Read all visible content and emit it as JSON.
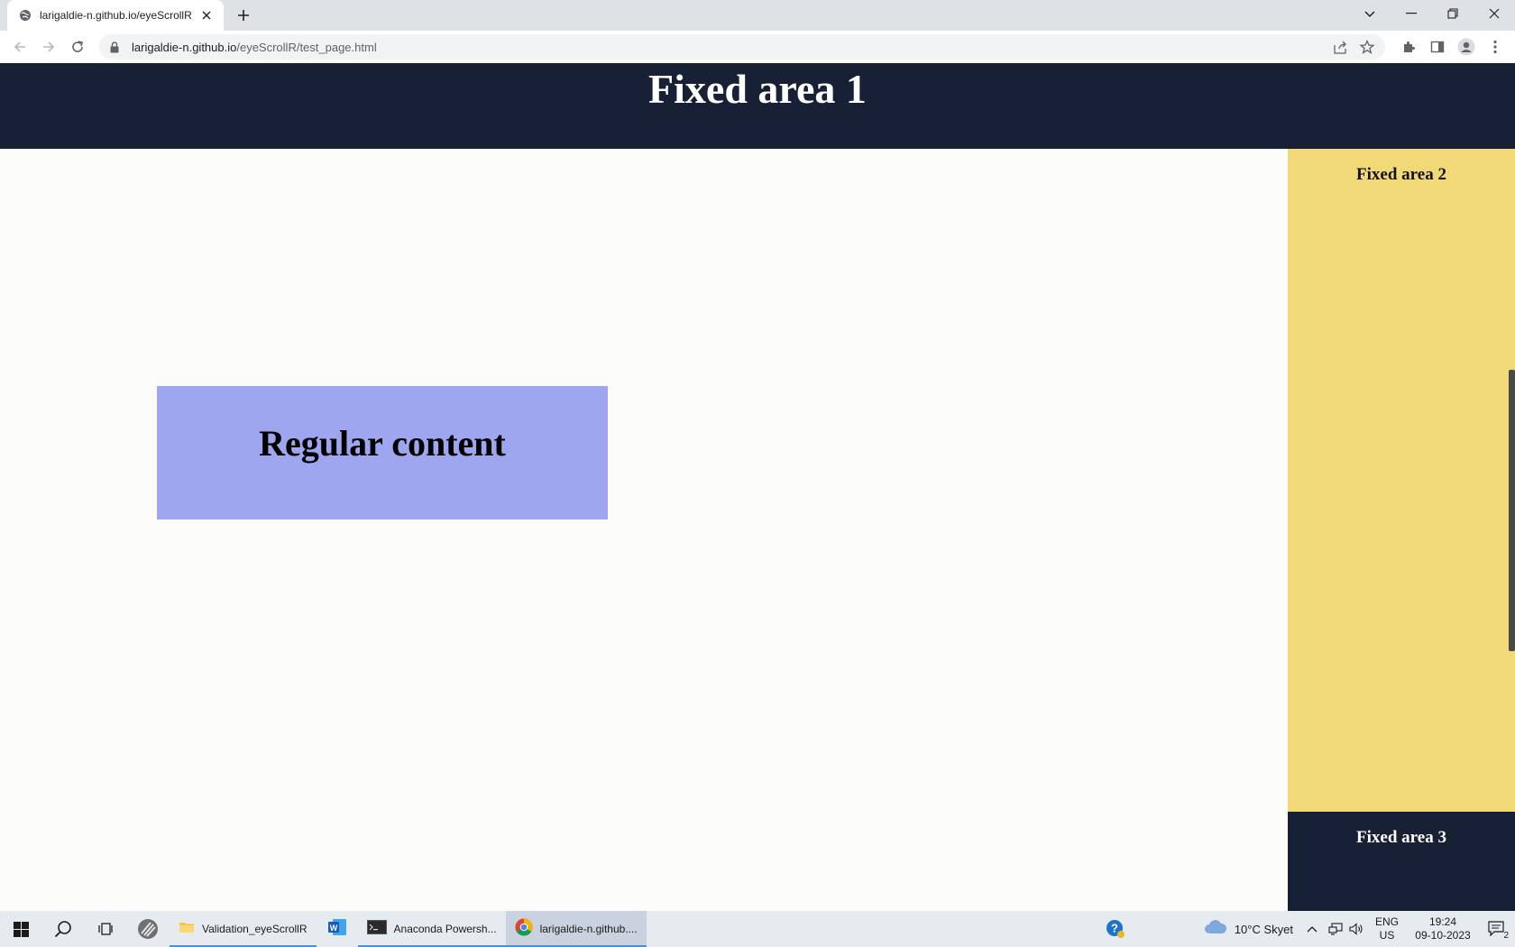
{
  "browser": {
    "tab": {
      "title": "larigaldie-n.github.io/eyeScrollR"
    },
    "url": {
      "host": "larigaldie-n.github.io",
      "path": "/eyeScrollR/test_page.html"
    }
  },
  "page": {
    "fixed_area_1": "Fixed area 1",
    "fixed_area_2": "Fixed area 2",
    "fixed_area_3": "Fixed area 3",
    "regular_content": "Regular content"
  },
  "taskbar": {
    "apps": [
      {
        "label": "Validation_eyeScrollR",
        "icon": "folder-icon"
      },
      {
        "label": "",
        "icon": "word-icon"
      },
      {
        "label": "Anaconda Powersh...",
        "icon": "terminal-icon"
      },
      {
        "label": "larigaldie-n.github....",
        "icon": "chrome-icon"
      }
    ],
    "weather": "10°C  Skyet",
    "language": [
      "ENG",
      "US"
    ],
    "time": "19:24",
    "date": "09-10-2023",
    "notifications": "2"
  },
  "colors": {
    "fixed_dark": "#172035",
    "fixed_yellow": "#f2d978",
    "regular_blue": "#9da6ee",
    "page_bg": "#fcfdfa"
  }
}
